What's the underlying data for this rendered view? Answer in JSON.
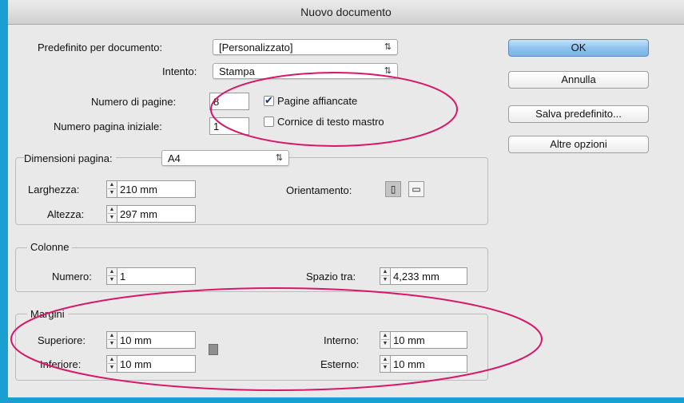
{
  "dialog": {
    "title": "Nuovo documento"
  },
  "top": {
    "preset_label": "Predefinito per documento:",
    "preset_value": "[Personalizzato]",
    "intent_label": "Intento:",
    "intent_value": "Stampa",
    "pages_label": "Numero di pagine:",
    "pages_value": "8",
    "start_label": "Numero pagina iniziale:",
    "start_value": "1",
    "facing_label": "Pagine affiancate",
    "facing_checked": true,
    "master_label": "Cornice di testo mastro",
    "master_checked": false
  },
  "page_size": {
    "label": "Dimensioni pagina:",
    "value": "A4",
    "width_label": "Larghezza:",
    "width_value": "210 mm",
    "height_label": "Altezza:",
    "height_value": "297 mm",
    "orientation_label": "Orientamento:"
  },
  "columns": {
    "legend": "Colonne",
    "number_label": "Numero:",
    "number_value": "1",
    "gutter_label": "Spazio tra:",
    "gutter_value": "4,233 mm"
  },
  "margins": {
    "legend": "Margini",
    "top_label": "Superiore:",
    "top_value": "10 mm",
    "bottom_label": "Inferiore:",
    "bottom_value": "10 mm",
    "inside_label": "Interno:",
    "inside_value": "10 mm",
    "outside_label": "Esterno:",
    "outside_value": "10 mm"
  },
  "buttons": {
    "ok": "OK",
    "cancel": "Annulla",
    "save_preset": "Salva predefinito...",
    "more_options": "Altre opzioni"
  },
  "arrow_glyph": "⇅",
  "check_glyph": "✔",
  "icons": [
    "chevron-updown-icon",
    "checkmark-icon",
    "portrait-orientation-icon",
    "landscape-orientation-icon",
    "chain-link-icon",
    "stepper-up-icon",
    "stepper-down-icon"
  ],
  "colors": {
    "background": "#1a9fd1",
    "annotation": "#d6176a",
    "default_button": "#8fc3ef"
  }
}
